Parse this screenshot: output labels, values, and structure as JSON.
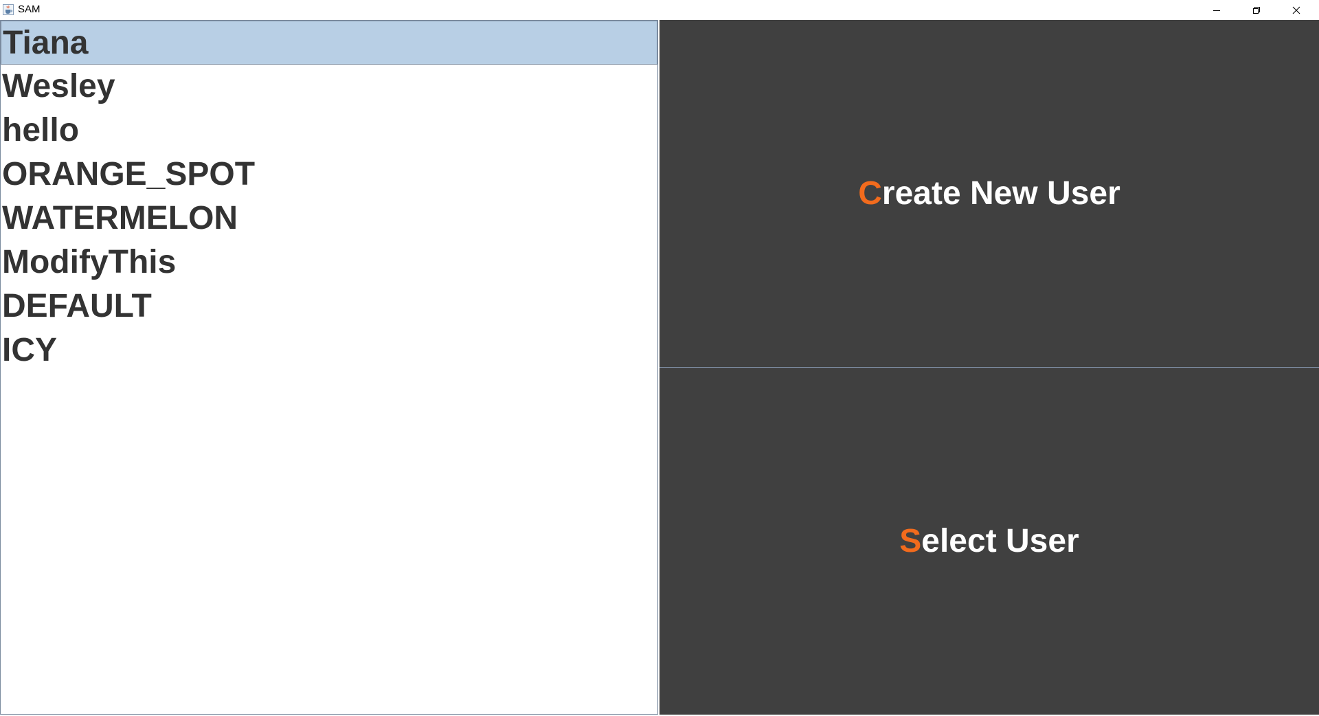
{
  "window": {
    "title": "SAM",
    "icon": "java-cup-icon",
    "controls": {
      "minimize_icon": "minimize-icon",
      "restore_icon": "restore-icon",
      "close_icon": "close-icon"
    }
  },
  "user_list": {
    "selected_index": 0,
    "items": [
      "Tiana",
      "Wesley",
      "hello",
      "ORANGE_SPOT",
      "WATERMELON",
      "ModifyThis",
      "DEFAULT",
      "ICY"
    ]
  },
  "actions": {
    "create": {
      "mnemonic": "C",
      "rest": "reate New User"
    },
    "select": {
      "mnemonic": "S",
      "rest": "elect User"
    }
  },
  "colors": {
    "accent": "#f26b1d",
    "panel_bg": "#404040",
    "selection_bg": "#b8cfe5",
    "list_text": "#333333"
  }
}
